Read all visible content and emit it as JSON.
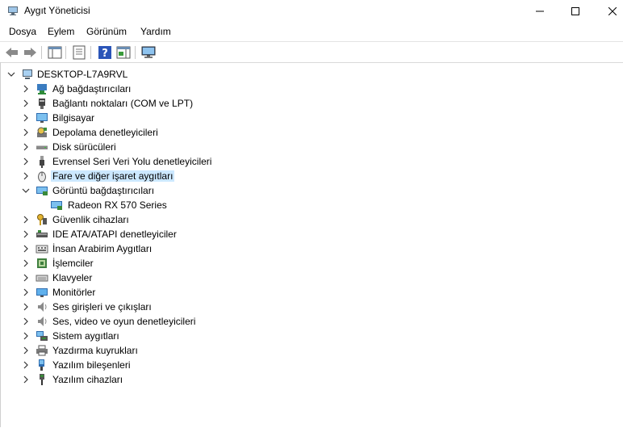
{
  "window": {
    "title": "Aygıt Yöneticisi"
  },
  "menu": {
    "items": [
      "Dosya",
      "Eylem",
      "Görünüm",
      "Yardım"
    ]
  },
  "toolbar": {
    "icons": [
      "back-arrow-icon",
      "forward-arrow-icon",
      "show-hide-tree-icon",
      "properties-icon",
      "help-icon",
      "action-pane-icon",
      "monitor-scan-icon"
    ]
  },
  "tree": {
    "root": "DESKTOP-L7A9RVL",
    "categories": [
      {
        "label": "Ağ bağdaştırıcıları",
        "icon": "network-adapter-icon"
      },
      {
        "label": "Bağlantı noktaları (COM ve LPT)",
        "icon": "port-icon"
      },
      {
        "label": "Bilgisayar",
        "icon": "computer-icon"
      },
      {
        "label": "Depolama denetleyicileri",
        "icon": "storage-controller-icon"
      },
      {
        "label": "Disk sürücüleri",
        "icon": "disk-drive-icon"
      },
      {
        "label": "Evrensel Seri Veri Yolu denetleyicileri",
        "icon": "usb-icon"
      },
      {
        "label": "Fare ve diğer işaret aygıtları",
        "icon": "mouse-icon"
      },
      {
        "label": "Görüntü bağdaştırıcıları",
        "icon": "display-adapter-icon"
      },
      {
        "label": "Radeon RX 570 Series",
        "icon": "gpu-icon"
      },
      {
        "label": "Güvenlik cihazları",
        "icon": "security-device-icon"
      },
      {
        "label": "IDE ATA/ATAPI denetleyiciler",
        "icon": "ide-controller-icon"
      },
      {
        "label": "İnsan Arabirim Aygıtları",
        "icon": "hid-icon"
      },
      {
        "label": "İşlemciler",
        "icon": "processor-icon"
      },
      {
        "label": "Klavyeler",
        "icon": "keyboard-icon"
      },
      {
        "label": "Monitörler",
        "icon": "monitor-icon"
      },
      {
        "label": "Ses girişleri ve çıkışları",
        "icon": "speaker-icon"
      },
      {
        "label": "Ses, video ve oyun denetleyicileri",
        "icon": "sound-controller-icon"
      },
      {
        "label": "Sistem aygıtları",
        "icon": "system-device-icon"
      },
      {
        "label": "Yazdırma kuyrukları",
        "icon": "printer-icon"
      },
      {
        "label": "Yazılım bileşenleri",
        "icon": "software-component-icon"
      },
      {
        "label": "Yazılım cihazları",
        "icon": "software-device-icon"
      }
    ]
  }
}
